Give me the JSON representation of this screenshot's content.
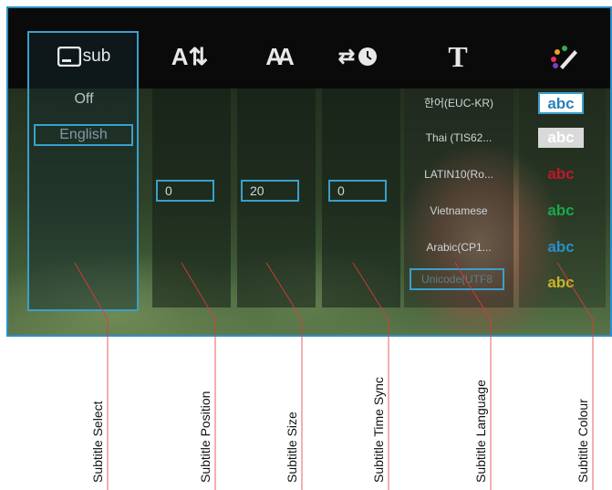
{
  "menu": {
    "icons": [
      {
        "name": "subtitle-select-icon",
        "text": "sub"
      },
      {
        "name": "subtitle-position-icon",
        "glyph": "A⇅"
      },
      {
        "name": "subtitle-size-icon",
        "glyph": "AA"
      },
      {
        "name": "subtitle-time-sync-icon",
        "glyph": "⇄"
      },
      {
        "name": "subtitle-language-icon",
        "glyph": "T"
      },
      {
        "name": "subtitle-colour-icon",
        "glyph": "✎"
      }
    ],
    "subtitle_select": {
      "off": "Off",
      "selected": "English"
    },
    "position_value": "0",
    "size_value": "20",
    "time_sync_value": "0",
    "languages": [
      "한어(EUC-KR)",
      "Thai (TIS62...",
      "LATIN10(Ro...",
      "Vietnamese",
      "Arabic(CP1...",
      "Unicode(UTF8"
    ],
    "colours": [
      {
        "text": "abc",
        "color": "#2a7fb8"
      },
      {
        "text": "abc",
        "color": "#9a9a9a"
      },
      {
        "text": "abc",
        "color": "#c0182a"
      },
      {
        "text": "abc",
        "color": "#1aa84a"
      },
      {
        "text": "abc",
        "color": "#2a8fc8"
      },
      {
        "text": "abc",
        "color": "#c8b42a"
      }
    ]
  },
  "callouts": [
    "Subtitle Select",
    "Subtitle Position",
    "Subtitle Size",
    "Subtitle Time Sync",
    "Subtitle Language",
    "Subtitle Colour"
  ],
  "accent": "#3aa0c9",
  "leader_color": "#e23a3a"
}
